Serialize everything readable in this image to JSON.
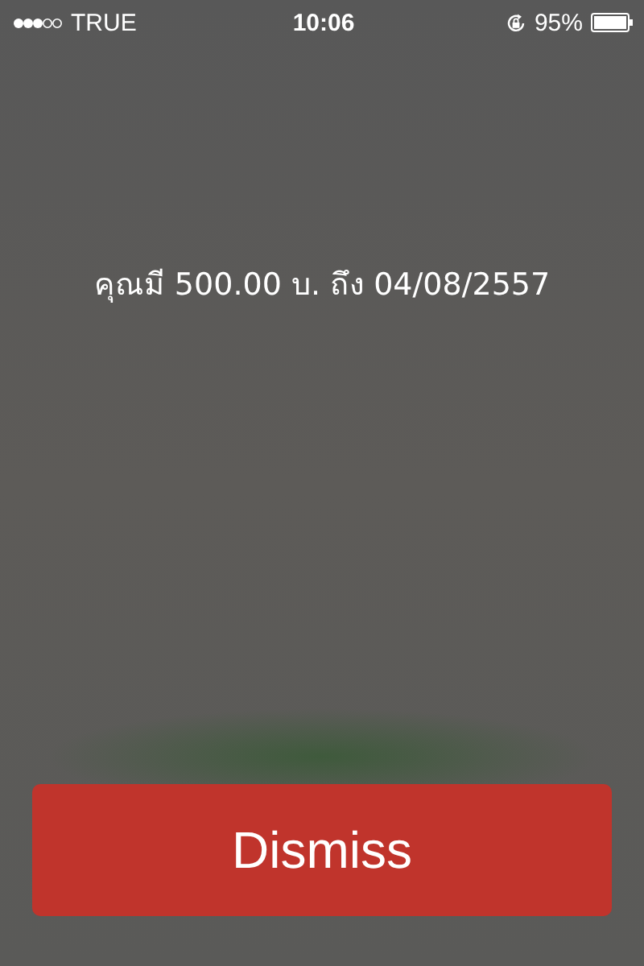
{
  "status_bar": {
    "carrier": "TRUE",
    "time": "10:06",
    "battery": "95%"
  },
  "message": "คุณมี 500.00 บ. ถึง 04/08/2557",
  "buttons": [
    "Dismiss"
  ]
}
